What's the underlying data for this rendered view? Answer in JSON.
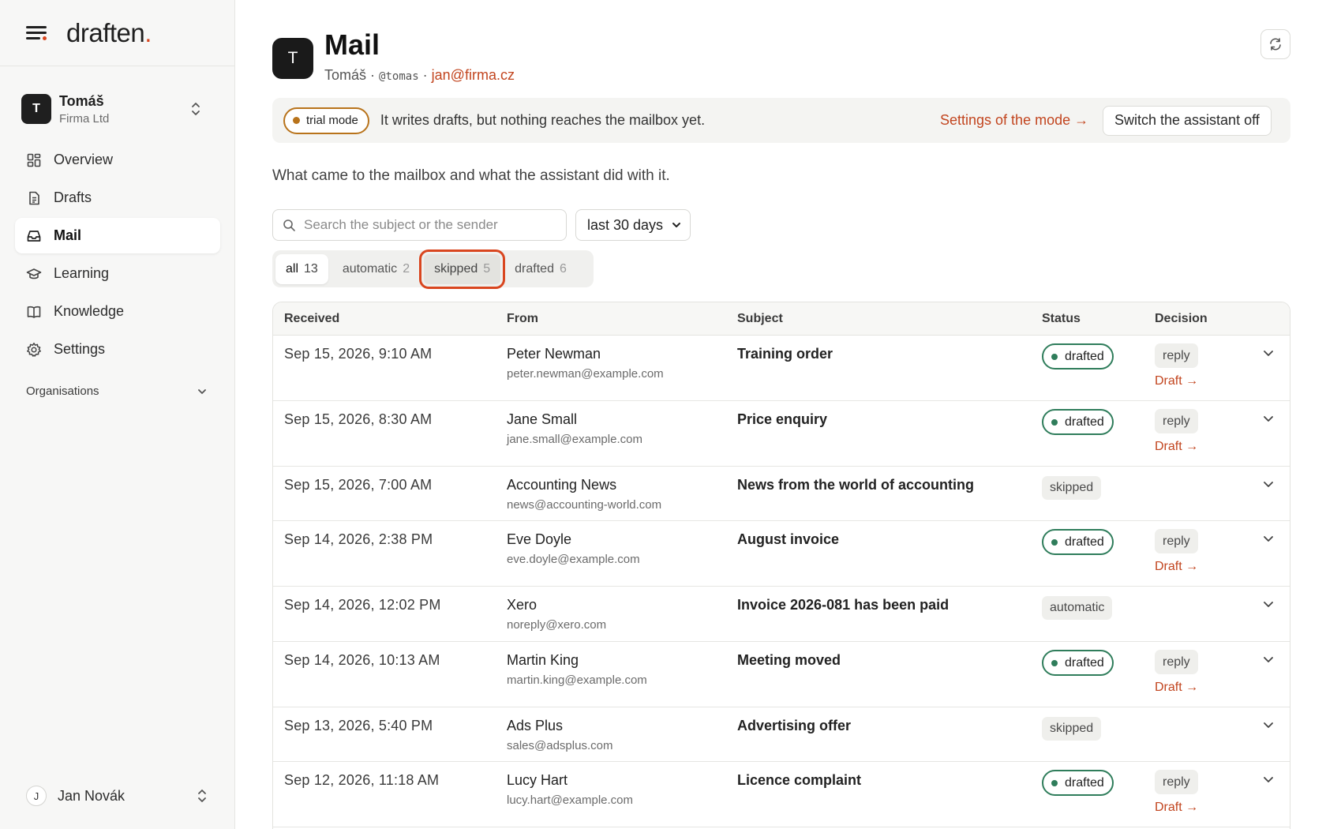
{
  "brand": {
    "logo_text": "draften",
    "logo_dot": "."
  },
  "account": {
    "initial": "T",
    "name": "Tomáš",
    "company": "Firma Ltd"
  },
  "nav": [
    {
      "label": "Overview",
      "icon": "grid-icon"
    },
    {
      "label": "Drafts",
      "icon": "document-icon"
    },
    {
      "label": "Mail",
      "icon": "inbox-icon",
      "active": true
    },
    {
      "label": "Learning",
      "icon": "graduation-cap-icon"
    },
    {
      "label": "Knowledge",
      "icon": "book-icon"
    },
    {
      "label": "Settings",
      "icon": "gear-icon"
    }
  ],
  "organisations_label": "Organisations",
  "user": {
    "initial": "J",
    "name": "Jan Novák"
  },
  "header": {
    "initial": "T",
    "title": "Mail",
    "owner": "Tomáš",
    "sep": "·",
    "handle": "@tomas",
    "email": "jan@firma.cz"
  },
  "banner": {
    "badge": "trial mode",
    "text": "It writes drafts, but nothing reaches the mailbox yet.",
    "settings_link": "Settings of the mode →",
    "switch_button": "Switch the assistant off"
  },
  "description": "What came to the mailbox and what the assistant did with it.",
  "filters": {
    "search_placeholder": "Search the subject or the sender",
    "period": "last 30 days"
  },
  "tabs": [
    {
      "label": "all",
      "count": "13"
    },
    {
      "label": "automatic",
      "count": "2"
    },
    {
      "label": "skipped",
      "count": "5"
    },
    {
      "label": "drafted",
      "count": "6"
    }
  ],
  "table": {
    "headers": {
      "received": "Received",
      "from": "From",
      "subject": "Subject",
      "status": "Status",
      "decision": "Decision"
    },
    "rows": [
      {
        "received": "Sep 15, 2026, 9:10 AM",
        "from_name": "Peter Newman",
        "from_email": "peter.newman@example.com",
        "subject": "Training order",
        "status": "drafted",
        "decision": "reply",
        "draft_link": "Draft →"
      },
      {
        "received": "Sep 15, 2026, 8:30 AM",
        "from_name": "Jane Small",
        "from_email": "jane.small@example.com",
        "subject": "Price enquiry",
        "status": "drafted",
        "decision": "reply",
        "draft_link": "Draft →"
      },
      {
        "received": "Sep 15, 2026, 7:00 AM",
        "from_name": "Accounting News",
        "from_email": "news@accounting-world.com",
        "subject": "News from the world of accounting",
        "status": "skipped",
        "decision": "",
        "draft_link": ""
      },
      {
        "received": "Sep 14, 2026, 2:38 PM",
        "from_name": "Eve Doyle",
        "from_email": "eve.doyle@example.com",
        "subject": "August invoice",
        "status": "drafted",
        "decision": "reply",
        "draft_link": "Draft →"
      },
      {
        "received": "Sep 14, 2026, 12:02 PM",
        "from_name": "Xero",
        "from_email": "noreply@xero.com",
        "subject": "Invoice 2026-081 has been paid",
        "status": "automatic",
        "decision": "",
        "draft_link": ""
      },
      {
        "received": "Sep 14, 2026, 10:13 AM",
        "from_name": "Martin King",
        "from_email": "martin.king@example.com",
        "subject": "Meeting moved",
        "status": "drafted",
        "decision": "reply",
        "draft_link": "Draft →"
      },
      {
        "received": "Sep 13, 2026, 5:40 PM",
        "from_name": "Ads Plus",
        "from_email": "sales@adsplus.com",
        "subject": "Advertising offer",
        "status": "skipped",
        "decision": "",
        "draft_link": ""
      },
      {
        "received": "Sep 12, 2026, 11:18 AM",
        "from_name": "Lucy Hart",
        "from_email": "lucy.hart@example.com",
        "subject": "Licence complaint",
        "status": "drafted",
        "decision": "reply",
        "draft_link": "Draft →"
      }
    ]
  },
  "colors": {
    "accent": "#d9461f",
    "link": "#c2451f",
    "drafted": "#2f7d5b",
    "trial": "#b8731b"
  }
}
